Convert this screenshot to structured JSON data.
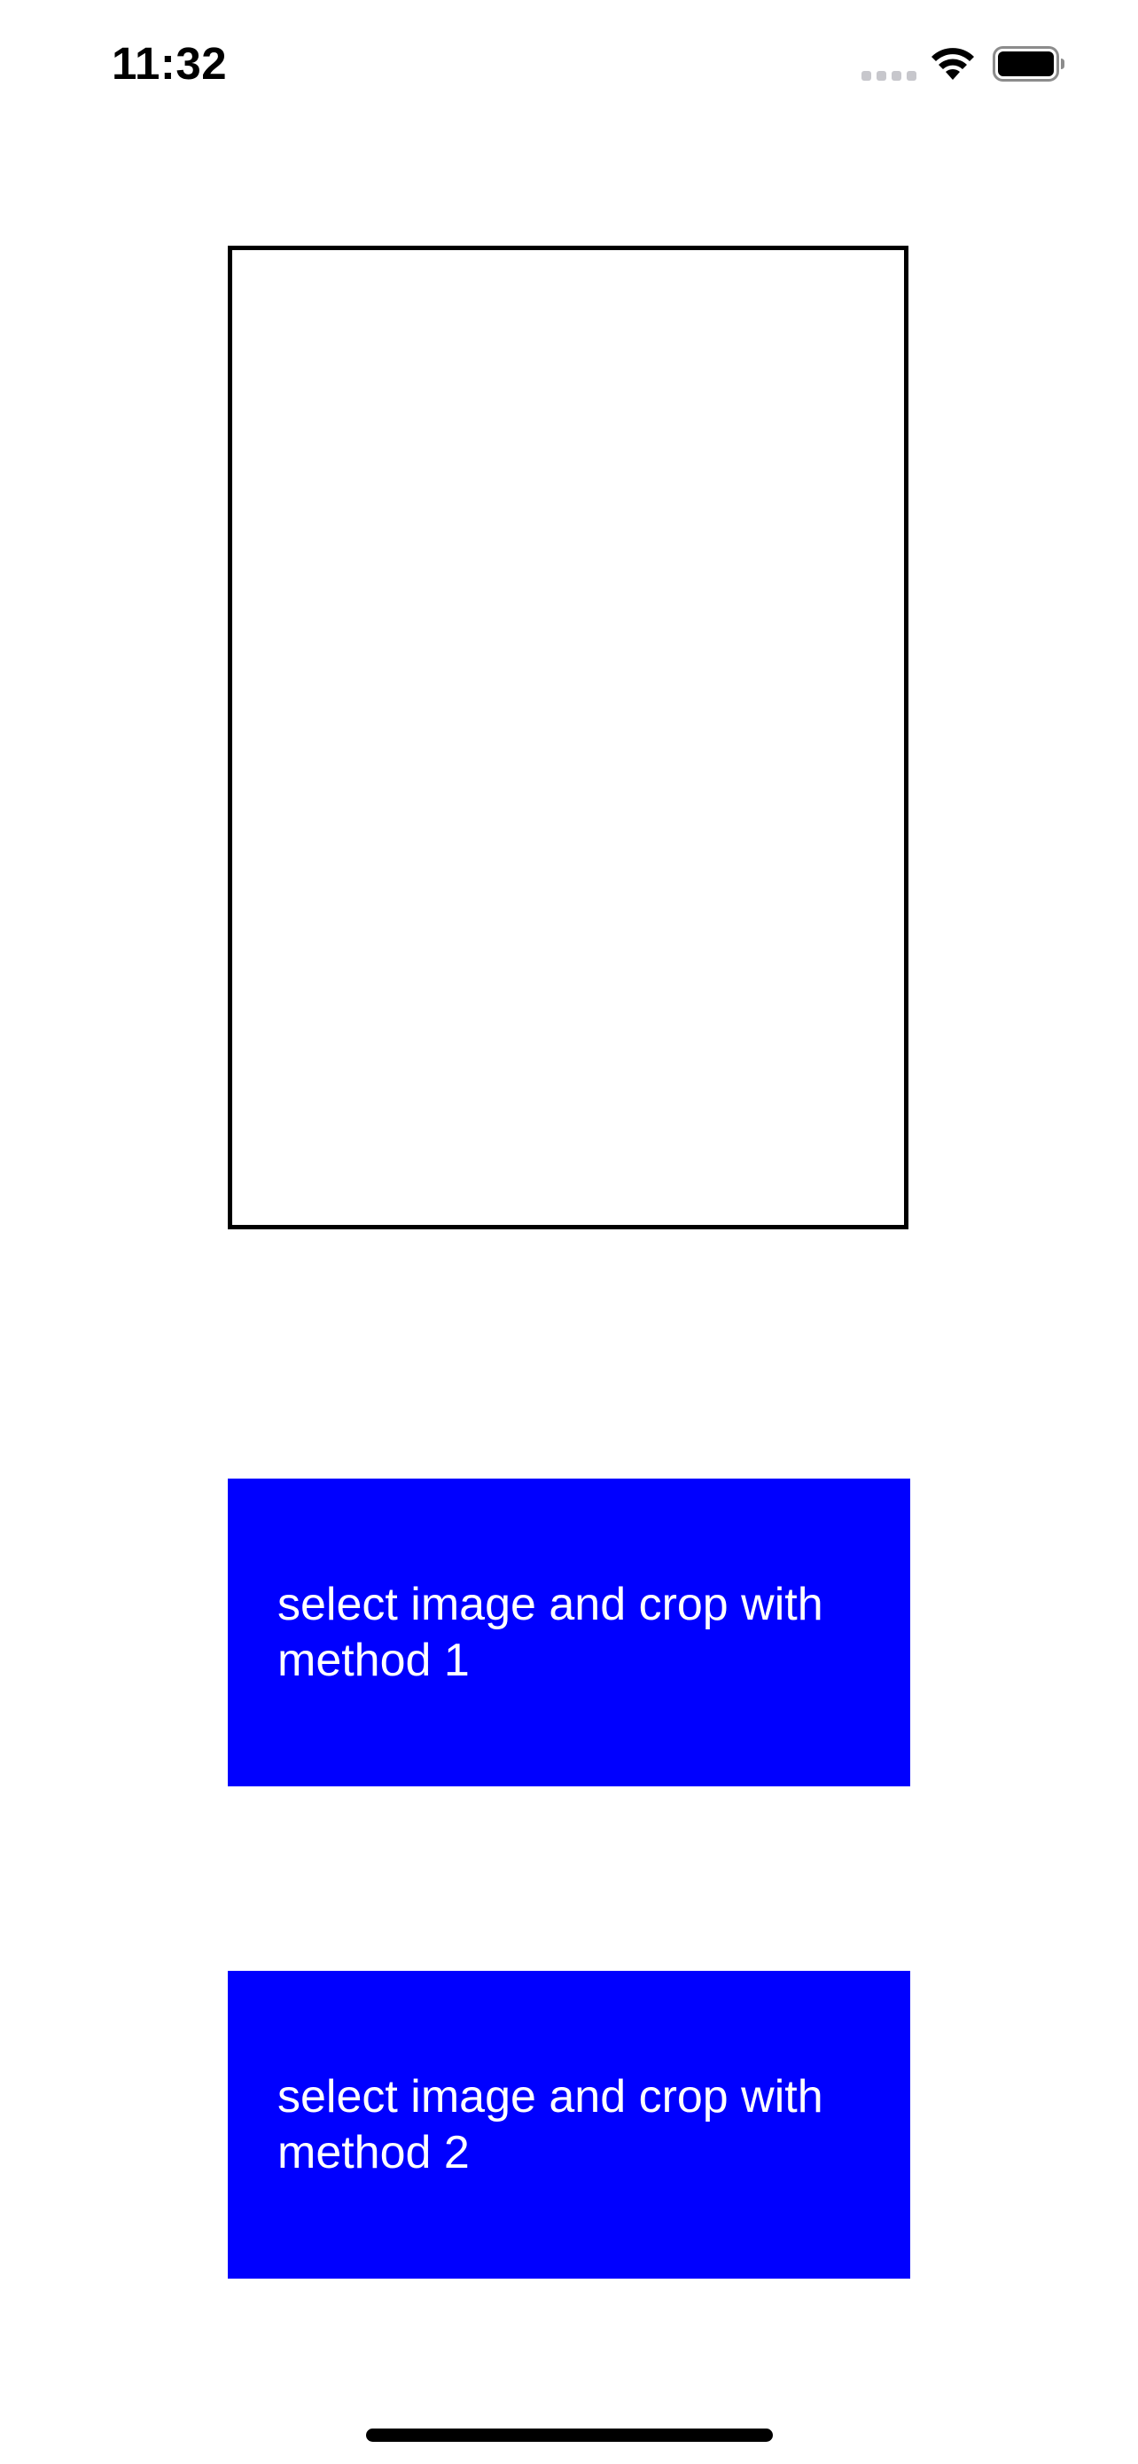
{
  "status_bar": {
    "time": "11:32",
    "icons": [
      "cellular-signal-icon",
      "wifi-icon",
      "battery-icon"
    ]
  },
  "image_preview": {
    "border_color": "#000000"
  },
  "buttons": [
    {
      "label": "select image and crop with\nmethod 1"
    },
    {
      "label": "select image and crop with\nmethod 2"
    }
  ],
  "colors": {
    "button_background": "#0000ff",
    "button_text": "#ffffff",
    "page_background": "#ffffff"
  }
}
